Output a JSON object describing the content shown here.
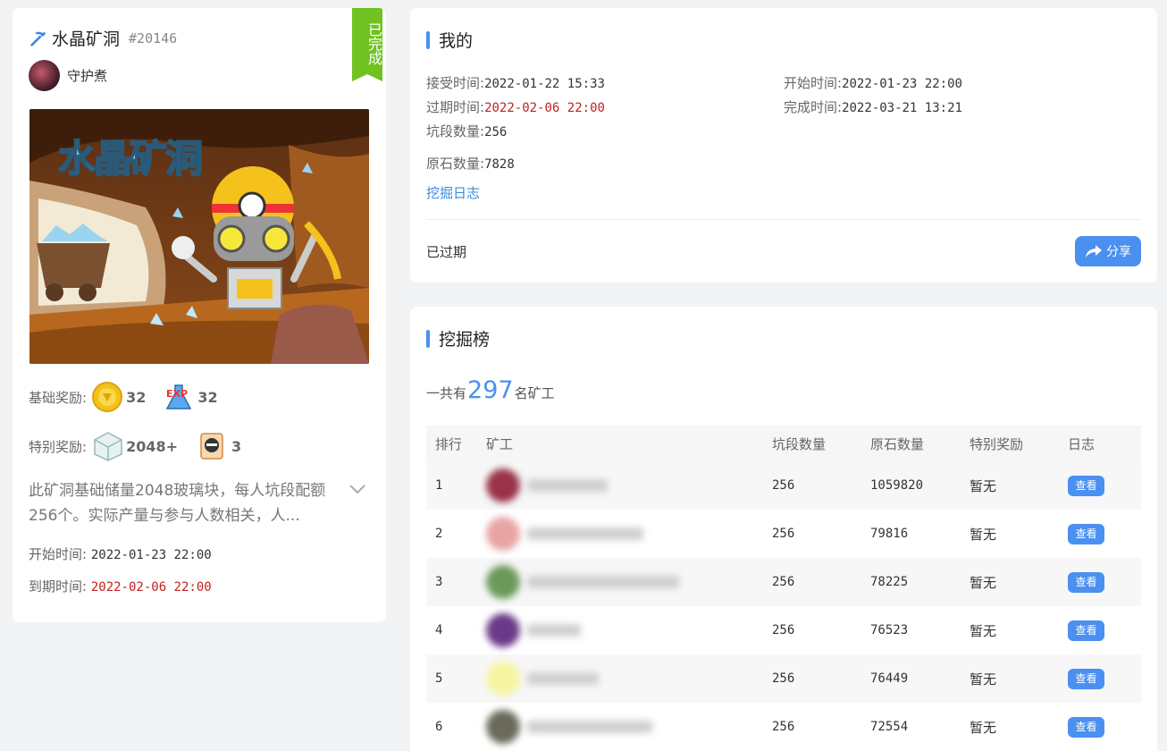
{
  "mine": {
    "name": "水晶矿洞",
    "id": "#20146",
    "ribbon": "已完成",
    "owner": "守护煮",
    "cover_title": "水晶矿洞",
    "base_reward_label": "基础奖励:",
    "base_rewards": [
      {
        "icon": "coin-icon",
        "value": "32"
      },
      {
        "icon": "exp-potion-icon",
        "value": "32"
      }
    ],
    "special_reward_label": "特别奖励:",
    "special_rewards": [
      {
        "icon": "glass-block-icon",
        "value": "2048+"
      },
      {
        "icon": "scroll-icon",
        "value": "3"
      }
    ],
    "description_line1": "此矿洞基础储量2048玻璃块，每人坑段配额",
    "description_line2": "256个。实际产量与参与人数相关，人...",
    "start_label": "开始时间:",
    "start_value": "2022-01-23 22:00",
    "due_label": "到期时间:",
    "due_value": "2022-02-06 22:00"
  },
  "mine_card": {
    "title": "我的",
    "accept_label": "接受时间:",
    "accept_value": "2022-01-22 15:33",
    "begin_label": "开始时间:",
    "begin_value": "2022-01-23 22:00",
    "expire_label": "过期时间:",
    "expire_value": "2022-02-06 22:00",
    "finish_label": "完成时间:",
    "finish_value": "2022-03-21 13:21",
    "segments_label": "坑段数量:",
    "segments_value": "256",
    "ore_label": "原石数量:",
    "ore_value": "7828",
    "log_link": "挖掘日志",
    "status": "已过期",
    "share_label": "分享"
  },
  "leaderboard": {
    "title": "挖掘榜",
    "summary_prefix": "一共有",
    "summary_count": "297",
    "summary_suffix": "名矿工",
    "headers": {
      "rank": "排行",
      "miner": "矿工",
      "segments": "坑段数量",
      "ore": "原石数量",
      "special": "特别奖励",
      "log": "日志"
    },
    "rows": [
      {
        "rank": "1",
        "segments": "256",
        "ore": "1059820",
        "special": "暂无",
        "view": "查看",
        "avatar_color": "#9a3248",
        "name_width": 90
      },
      {
        "rank": "2",
        "segments": "256",
        "ore": "79816",
        "special": "暂无",
        "view": "查看",
        "avatar_color": "#e8a4a4",
        "name_width": 130
      },
      {
        "rank": "3",
        "segments": "256",
        "ore": "78225",
        "special": "暂无",
        "view": "查看",
        "avatar_color": "#6a9a5a",
        "name_width": 170
      },
      {
        "rank": "4",
        "segments": "256",
        "ore": "76523",
        "special": "暂无",
        "view": "查看",
        "avatar_color": "#6a3a8a",
        "name_width": 60
      },
      {
        "rank": "5",
        "segments": "256",
        "ore": "76449",
        "special": "暂无",
        "view": "查看",
        "avatar_color": "#f6f4a0",
        "name_width": 80
      },
      {
        "rank": "6",
        "segments": "256",
        "ore": "72554",
        "special": "暂无",
        "view": "查看",
        "avatar_color": "#6a6a5a",
        "name_width": 140
      }
    ]
  }
}
